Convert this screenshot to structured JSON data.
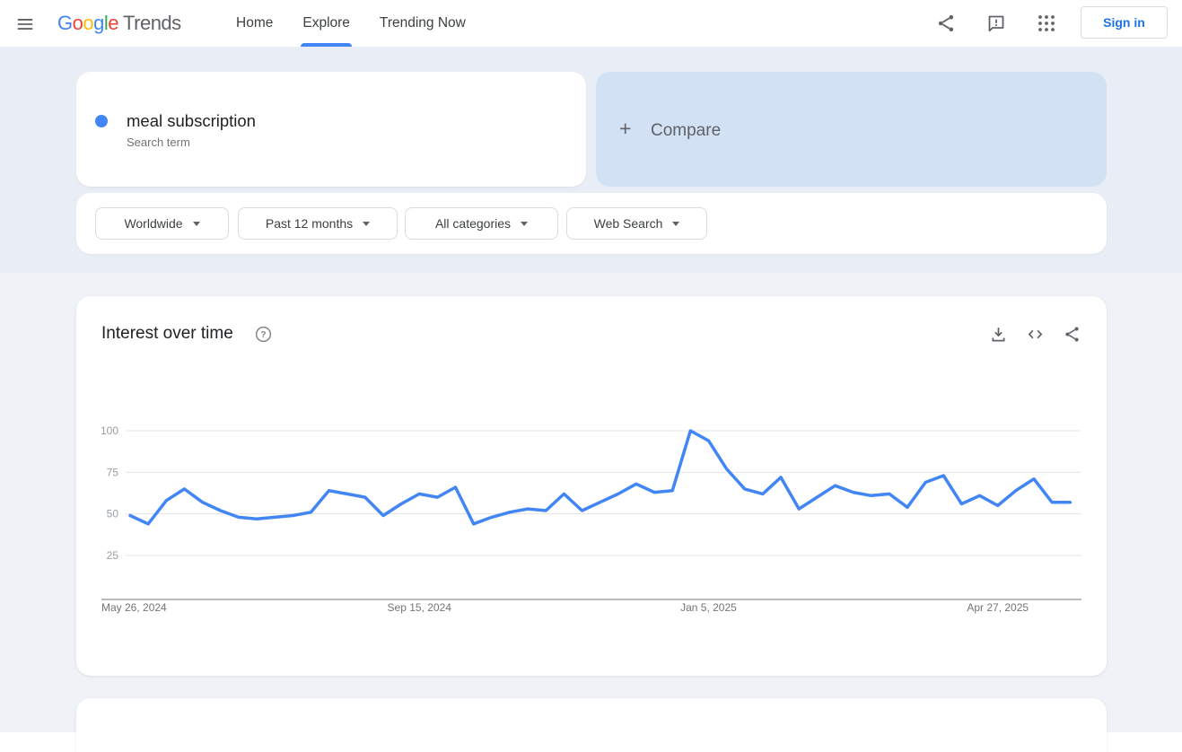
{
  "header": {
    "logo": {
      "letters": [
        {
          "ch": "G",
          "color": "#4285F4"
        },
        {
          "ch": "o",
          "color": "#EA4335"
        },
        {
          "ch": "o",
          "color": "#FBBC05"
        },
        {
          "ch": "g",
          "color": "#4285F4"
        },
        {
          "ch": "l",
          "color": "#34A853"
        },
        {
          "ch": "e",
          "color": "#EA4335"
        }
      ],
      "suffix": "Trends"
    },
    "nav": [
      {
        "label": "Home",
        "active": false
      },
      {
        "label": "Explore",
        "active": true
      },
      {
        "label": "Trending Now",
        "active": false
      }
    ],
    "sign_in_label": "Sign in"
  },
  "hero": {
    "search_term": {
      "term": "meal subscription",
      "type": "Search term",
      "dot_color": "#4285f4"
    },
    "compare": {
      "plus": "+",
      "label": "Compare"
    },
    "filters": [
      {
        "label": "Worldwide"
      },
      {
        "label": "Past 12 months"
      },
      {
        "label": "All categories"
      },
      {
        "label": "Web Search"
      }
    ]
  },
  "interest_card": {
    "title": "Interest over time"
  },
  "chart_data": {
    "type": "line",
    "title": "Interest over time",
    "x_interval": "weekly",
    "x_tick_labels": [
      "May 26, 2024",
      "Sep 15, 2024",
      "Jan 5, 2025",
      "Apr 27, 2025"
    ],
    "x_tick_indices": [
      0,
      16,
      32,
      48
    ],
    "y_ticks": [
      25,
      50,
      75,
      100
    ],
    "ylim": [
      0,
      100
    ],
    "grid": true,
    "legend": "none",
    "series": [
      {
        "name": "meal subscription",
        "color": "#4285f4",
        "values": [
          49,
          44,
          58,
          65,
          57,
          52,
          48,
          47,
          48,
          49,
          51,
          64,
          62,
          60,
          49,
          56,
          62,
          60,
          66,
          44,
          48,
          51,
          53,
          52,
          62,
          52,
          57,
          62,
          68,
          63,
          64,
          100,
          94,
          77,
          65,
          62,
          72,
          53,
          60,
          67,
          63,
          61,
          62,
          54,
          69,
          73,
          56,
          61,
          55,
          64,
          71,
          57,
          57
        ]
      }
    ]
  },
  "colors": {
    "hero_bg": "#e9edf5",
    "page_bg": "#eff2f7",
    "compare_bg": "#d3e1f4",
    "accent_blue": "#1a73e8",
    "line_blue": "#4285f4",
    "icon_gray": "#5f6368",
    "grid_gray": "#e4e4e7",
    "axis_gray": "#757575",
    "y_tick_label": "#9aa0a6",
    "x_tick_label": "#757575"
  }
}
